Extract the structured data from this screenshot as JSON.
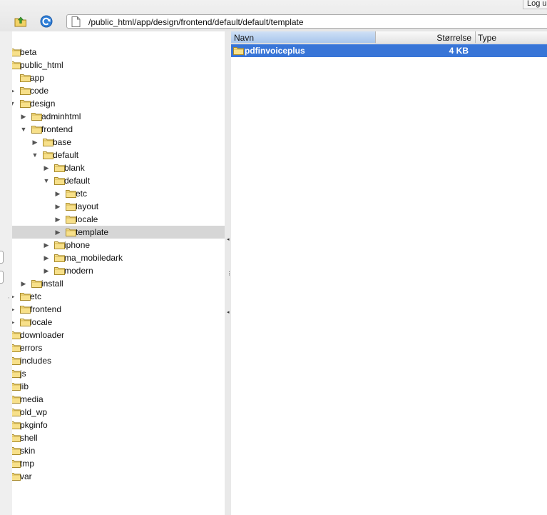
{
  "header": {
    "logout_label": "Log ud",
    "path": "/public_html/app/design/frontend/default/default/template"
  },
  "icons": {
    "upload": "folder-upload-icon",
    "refresh": "refresh-icon",
    "path": "document-icon",
    "folder": "folder-icon"
  },
  "colors": {
    "folder_fill": "#f7e08a",
    "selection_blue": "#3875d7",
    "tree_selection": "#d6d6d6"
  },
  "tree": [
    {
      "label": "beta",
      "depth": 0,
      "expander": "none"
    },
    {
      "label": "public_html",
      "depth": 0,
      "expander": "none"
    },
    {
      "label": "app",
      "depth": 1,
      "expander": "none"
    },
    {
      "label": "code",
      "depth": 1,
      "expander": "collapsed"
    },
    {
      "label": "design",
      "depth": 1,
      "expander": "expanded"
    },
    {
      "label": "adminhtml",
      "depth": 2,
      "expander": "collapsed"
    },
    {
      "label": "frontend",
      "depth": 2,
      "expander": "expanded"
    },
    {
      "label": "base",
      "depth": 3,
      "expander": "collapsed"
    },
    {
      "label": "default",
      "depth": 3,
      "expander": "expanded"
    },
    {
      "label": "blank",
      "depth": 4,
      "expander": "collapsed"
    },
    {
      "label": "default",
      "depth": 4,
      "expander": "expanded"
    },
    {
      "label": "etc",
      "depth": 5,
      "expander": "collapsed"
    },
    {
      "label": "layout",
      "depth": 5,
      "expander": "collapsed"
    },
    {
      "label": "locale",
      "depth": 5,
      "expander": "collapsed"
    },
    {
      "label": "template",
      "depth": 5,
      "expander": "collapsed",
      "selected": true
    },
    {
      "label": "iphone",
      "depth": 4,
      "expander": "collapsed"
    },
    {
      "label": "ma_mobiledark",
      "depth": 4,
      "expander": "collapsed"
    },
    {
      "label": "modern",
      "depth": 4,
      "expander": "collapsed"
    },
    {
      "label": "install",
      "depth": 2,
      "expander": "collapsed"
    },
    {
      "label": "etc",
      "depth": 1,
      "expander": "collapsed"
    },
    {
      "label": "frontend",
      "depth": 1,
      "expander": "collapsed"
    },
    {
      "label": "locale",
      "depth": 1,
      "expander": "collapsed"
    },
    {
      "label": "downloader",
      "depth": 0,
      "expander": "none"
    },
    {
      "label": "errors",
      "depth": 0,
      "expander": "none"
    },
    {
      "label": "includes",
      "depth": 0,
      "expander": "none"
    },
    {
      "label": "js",
      "depth": 0,
      "expander": "none"
    },
    {
      "label": "lib",
      "depth": 0,
      "expander": "none"
    },
    {
      "label": "media",
      "depth": 0,
      "expander": "none"
    },
    {
      "label": "old_wp",
      "depth": 0,
      "expander": "none"
    },
    {
      "label": "pkginfo",
      "depth": 0,
      "expander": "none"
    },
    {
      "label": "shell",
      "depth": 0,
      "expander": "none"
    },
    {
      "label": "skin",
      "depth": 0,
      "expander": "none"
    },
    {
      "label": "tmp",
      "depth": 0,
      "expander": "none"
    },
    {
      "label": "var",
      "depth": 0,
      "expander": "none"
    }
  ],
  "filelist": {
    "columns": {
      "name": "Navn",
      "size": "Størrelse",
      "type": "Type"
    },
    "rows": [
      {
        "name": "pdfinvoiceplus",
        "size": "4 KB",
        "type": "",
        "selected": true
      }
    ]
  }
}
